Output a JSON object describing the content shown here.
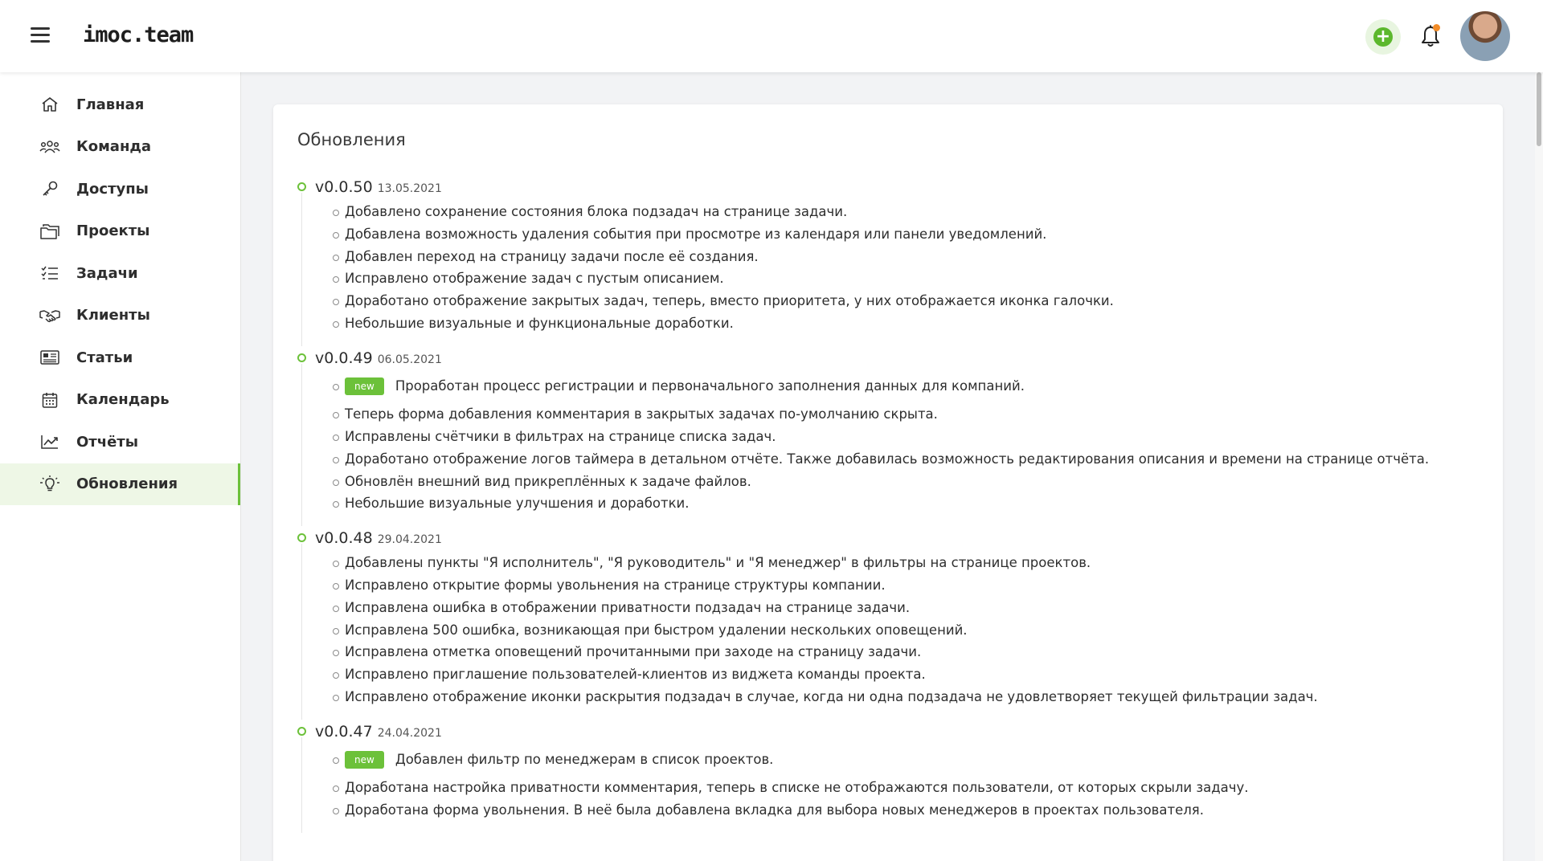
{
  "header": {
    "logo": "imoc.team",
    "menu_icon": "hamburger-menu-icon",
    "add_icon": "plus-icon",
    "bell_icon": "bell-icon",
    "accent": "#6cc13a",
    "notification_dot_color": "#f28c28"
  },
  "sidebar": {
    "items": [
      {
        "label": "Главная",
        "icon": "home-icon"
      },
      {
        "label": "Команда",
        "icon": "team-icon"
      },
      {
        "label": "Доступы",
        "icon": "key-icon"
      },
      {
        "label": "Проекты",
        "icon": "folder-icon"
      },
      {
        "label": "Задачи",
        "icon": "tasks-list-icon"
      },
      {
        "label": "Клиенты",
        "icon": "handshake-icon"
      },
      {
        "label": "Статьи",
        "icon": "newspaper-icon"
      },
      {
        "label": "Календарь",
        "icon": "calendar-icon"
      },
      {
        "label": "Отчёты",
        "icon": "chart-icon"
      },
      {
        "label": "Обновления",
        "icon": "lightbulb-icon",
        "active": true
      }
    ]
  },
  "main": {
    "title": "Обновления",
    "badge_label": "new",
    "versions": [
      {
        "version": "v0.0.50",
        "date": "13.05.2021",
        "items": [
          "Добавлено сохранение состояния блока подзадач на странице задачи.",
          "Добавлена возможность удаления события при просмотре из календаря или панели уведомлений.",
          "Добавлен переход на страницу задачи после её создания.",
          "Исправлено отображение задач с пустым описанием.",
          "Доработано отображение закрытых задач, теперь, вместо приоритета, у них отображается иконка галочки.",
          "Небольшие визуальные и функциональные доработки."
        ]
      },
      {
        "version": "v0.0.49",
        "date": "06.05.2021",
        "new_item": "Проработан процесс регистрации и первоначального заполнения данных для компаний.",
        "items": [
          "Теперь форма добавления комментария в закрытых задачах по-умолчанию скрыта.",
          "Исправлены счётчики в фильтрах на странице списка задач.",
          "Доработано отображение логов таймера в детальном отчёте. Также добавилась возможность редактирования описания и времени на странице отчёта.",
          "Обновлён внешний вид прикреплённых к задаче файлов.",
          "Небольшие визуальные улучшения и доработки."
        ]
      },
      {
        "version": "v0.0.48",
        "date": "29.04.2021",
        "items": [
          "Добавлены пункты \"Я исполнитель\", \"Я руководитель\" и \"Я менеджер\" в фильтры на странице проектов.",
          "Исправлено открытие формы увольнения на странице структуры компании.",
          "Исправлена ошибка в отображении приватности подзадач на странице задачи.",
          "Исправлена 500 ошибка, возникающая при быстром удалении нескольких оповещений.",
          "Исправлена отметка оповещений прочитанными при заходе на страницу задачи.",
          "Исправлено приглашение пользователей-клиентов из виджета команды проекта.",
          "Исправлено отображение иконки раскрытия подзадач в случае, когда ни одна подзадача не удовлетворяет текущей фильтрации задач."
        ]
      },
      {
        "version": "v0.0.47",
        "date": "24.04.2021",
        "new_item": "Добавлен фильтр по менеджерам в список проектов.",
        "items": [
          "Доработана настройка приватности комментария, теперь в списке не отображаются пользователи, от которых скрыли задачу.",
          "Доработана форма увольнения. В неё была добавлена вкладка для выбора новых менеджеров в проектах пользователя."
        ]
      }
    ]
  }
}
